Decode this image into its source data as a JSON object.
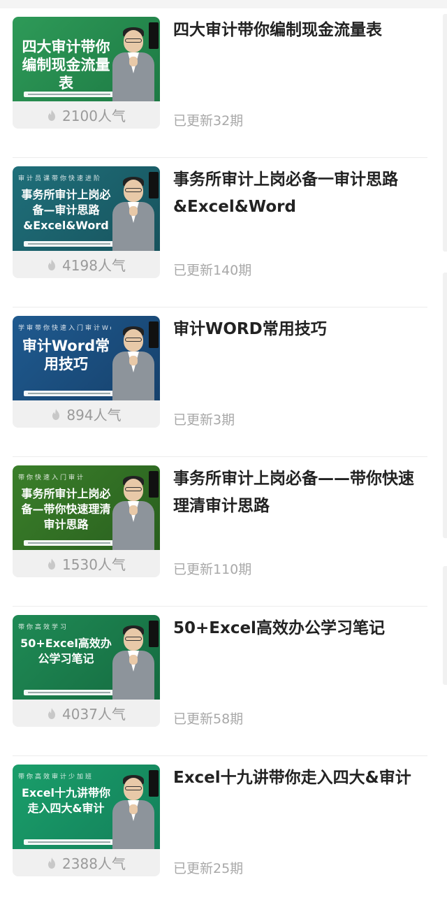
{
  "courses": [
    {
      "title": "四大审计带你编制现金流量表",
      "popularity": "2100人气",
      "update": "已更新32期",
      "thumb_title": "四大审计带你编制现金流量表",
      "thumb_decor": "",
      "theme": [
        "#2e9a58",
        "#1d7a44"
      ]
    },
    {
      "title": "事务所审计上岗必备一审计思路&Excel&Word",
      "popularity": "4198人气",
      "update": "已更新140期",
      "thumb_title": "事务所审计上岗必备—审计思路&Excel&Word",
      "thumb_decor": "审计员课带你快速进阶",
      "theme": [
        "#1f6f7a",
        "#17535d"
      ]
    },
    {
      "title": "审计WORD常用技巧",
      "popularity": "894人气",
      "update": "已更新3期",
      "thumb_title": "审计Word常用技巧",
      "thumb_decor": "学审带你快速入门审计Word",
      "theme": [
        "#1f5a8f",
        "#16416c"
      ]
    },
    {
      "title": "事务所审计上岗必备——带你快速理清审计思路",
      "popularity": "1530人气",
      "update": "已更新110期",
      "thumb_title": "事务所审计上岗必备—带你快速理清审计思路",
      "thumb_decor": "带你快速入门审计",
      "theme": [
        "#3a7f2a",
        "#295f1e"
      ]
    },
    {
      "title": "50+Excel高效办公学习笔记",
      "popularity": "4037人气",
      "update": "已更新58期",
      "thumb_title": "50+Excel高效办公学习笔记",
      "thumb_decor": "带你高效学习",
      "theme": [
        "#1f8a55",
        "#156b40"
      ]
    },
    {
      "title": "Excel十九讲带你走入四大&审计",
      "popularity": "2388人气",
      "update": "已更新25期",
      "thumb_title": "Excel十九讲带你走入四大&审计",
      "thumb_decor": "带你高效审计少加班",
      "theme": [
        "#1a9e6a",
        "#13805a"
      ]
    }
  ]
}
